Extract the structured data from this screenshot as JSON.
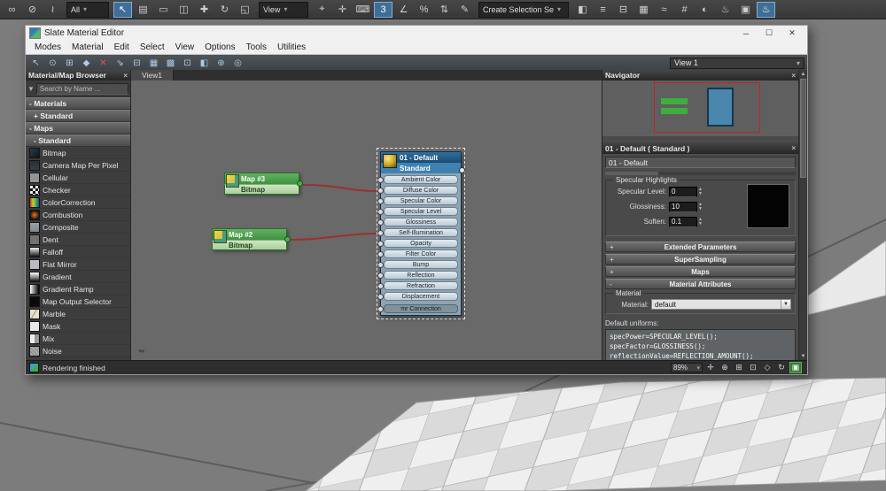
{
  "ui": {
    "close": "×",
    "funnel": "▼",
    "pan_glyph": "●●"
  },
  "top_toolbar": {
    "selection_filter": "All",
    "coord_system": "View",
    "named_selection": "Create Selection Se",
    "icons_g1": [
      {
        "name": "select-and-link-icon",
        "glyph": "∞"
      },
      {
        "name": "unlink-selection-icon",
        "glyph": "⊘"
      },
      {
        "name": "bind-to-spacewarp-icon",
        "glyph": "≀"
      }
    ],
    "icons_g2": [
      {
        "name": "select-object-icon",
        "glyph": "↖",
        "active": true
      },
      {
        "name": "select-by-name-icon",
        "glyph": "▤"
      },
      {
        "name": "rectangular-selection-icon",
        "glyph": "▭"
      },
      {
        "name": "window-crossing-icon",
        "glyph": "◫"
      },
      {
        "name": "select-and-move-icon",
        "glyph": "✚"
      },
      {
        "name": "select-and-rotate-icon",
        "glyph": "↻"
      },
      {
        "name": "select-and-scale-icon",
        "glyph": "◱"
      }
    ],
    "icons_g3": [
      {
        "name": "use-pivot-center-icon",
        "glyph": "⌖"
      },
      {
        "name": "select-and-manipulate-icon",
        "glyph": "✛"
      },
      {
        "name": "keyboard-override-icon",
        "glyph": "⌨"
      },
      {
        "name": "snap-toggle-3d-icon",
        "glyph": "3",
        "active": true
      },
      {
        "name": "angle-snap-icon",
        "glyph": "∠"
      },
      {
        "name": "percent-snap-icon",
        "glyph": "%"
      },
      {
        "name": "spinner-snap-icon",
        "glyph": "⇅"
      },
      {
        "name": "edit-selection-set-icon",
        "glyph": "✎"
      }
    ],
    "icons_g4": [
      {
        "name": "mirror-icon",
        "glyph": "◧"
      },
      {
        "name": "align-icon",
        "glyph": "≡"
      },
      {
        "name": "layer-manager-icon",
        "glyph": "⊟"
      },
      {
        "name": "graphite-ribbon-icon",
        "glyph": "▦"
      },
      {
        "name": "curve-editor-icon",
        "glyph": "≈"
      },
      {
        "name": "schematic-view-icon",
        "glyph": "#"
      },
      {
        "name": "material-editor-icon",
        "glyph": "◐"
      },
      {
        "name": "render-setup-icon",
        "glyph": "♨"
      },
      {
        "name": "rendered-frame-icon",
        "glyph": "▣"
      },
      {
        "name": "render-production-icon",
        "glyph": "♨",
        "active": true
      }
    ]
  },
  "window": {
    "title": "Slate Material Editor",
    "controls": {
      "minimize": "─",
      "maximize": "☐",
      "close": "✕"
    },
    "menus": [
      "Modes",
      "Material",
      "Edit",
      "Select",
      "View",
      "Options",
      "Tools",
      "Utilities"
    ],
    "toolbar_icons": [
      {
        "name": "select-tool-icon",
        "glyph": "↖"
      },
      {
        "name": "pick-material-from-object-icon",
        "glyph": "⊙"
      },
      {
        "name": "put-to-library-icon",
        "glyph": "⊞"
      },
      {
        "name": "assign-material-to-selection-icon",
        "glyph": "◆"
      },
      {
        "name": "delete-selected-icon",
        "glyph": "✕",
        "tone": "red"
      },
      {
        "name": "move-children-icon",
        "glyph": "⇘"
      },
      {
        "name": "hide-unused-nodeslots-icon",
        "glyph": "⊟"
      },
      {
        "name": "show-grid-icon",
        "glyph": "▦"
      },
      {
        "name": "show-background-icon",
        "glyph": "▩"
      },
      {
        "name": "layout-all-icon",
        "glyph": "⊡"
      },
      {
        "name": "show-shaded-material-icon",
        "glyph": "◧"
      },
      {
        "name": "zoom-extents-icon",
        "glyph": "⊕"
      },
      {
        "name": "material-id-channel-icon",
        "glyph": "◎"
      }
    ],
    "view_selector": "View 1",
    "view_tab": "View1"
  },
  "browser": {
    "title": "Material/Map Browser",
    "search_placeholder": "Search by Name ...",
    "groups": [
      {
        "label": "- Materials"
      },
      {
        "label": "+ Standard"
      },
      {
        "label": "- Maps"
      },
      {
        "label": "- Standard"
      }
    ],
    "maps": [
      {
        "label": "Bitmap",
        "icon": "bitmap-icon"
      },
      {
        "label": "Camera Map Per Pixel",
        "icon": "camera-map-icon"
      },
      {
        "label": "Cellular",
        "icon": "cellular-icon"
      },
      {
        "label": "Checker",
        "icon": "checker-icon"
      },
      {
        "label": "ColorCorrection",
        "icon": "colorcorrection-icon"
      },
      {
        "label": "Combustion",
        "icon": "combustion-icon"
      },
      {
        "label": "Composite",
        "icon": "composite-icon"
      },
      {
        "label": "Dent",
        "icon": "dent-icon"
      },
      {
        "label": "Falloff",
        "icon": "falloff-icon"
      },
      {
        "label": "Flat Mirror",
        "icon": "flat-mirror-icon"
      },
      {
        "label": "Gradient",
        "icon": "gradient-icon"
      },
      {
        "label": "Gradient Ramp",
        "icon": "gradient-ramp-icon"
      },
      {
        "label": "Map Output Selector",
        "icon": "map-output-icon"
      },
      {
        "label": "Marble",
        "icon": "marble-icon"
      },
      {
        "label": "Mask",
        "icon": "mask-icon"
      },
      {
        "label": "Mix",
        "icon": "mix-icon"
      },
      {
        "label": "Noise",
        "icon": "noise-icon"
      }
    ]
  },
  "canvas": {
    "nodes": {
      "map3": {
        "title": "Map #3",
        "subtitle": "Bitmap"
      },
      "map2": {
        "title": "Map #2",
        "subtitle": "Bitmap"
      },
      "material": {
        "title": "01 - Default",
        "subtitle": "Standard",
        "slots": [
          "Ambient Color",
          "Diffuse Color",
          "Specular Color",
          "Specular Level",
          "Glossiness",
          "Self-Illumination",
          "Opacity",
          "Filter Color",
          "Bump",
          "Reflection",
          "Refraction",
          "Displacement"
        ],
        "extra_slot": "mr Connection"
      }
    },
    "wire_color": "#9e2f2f"
  },
  "navigator": {
    "title": "Navigator"
  },
  "params": {
    "header": "01 - Default  ( Standard )",
    "name": "01 - Default",
    "specular_group": "Specular Highlights",
    "fields": [
      {
        "label": "Specular Level:",
        "value": "0"
      },
      {
        "label": "Glossiness:",
        "value": "10"
      },
      {
        "label": "Soften:",
        "value": "0.1"
      }
    ],
    "rollouts": [
      {
        "label": "Extended Parameters",
        "state": "+"
      },
      {
        "label": "SuperSampling",
        "state": "+"
      },
      {
        "label": "Maps",
        "state": "+"
      },
      {
        "label": "Material Attributes",
        "state": "-"
      }
    ],
    "material_group": "Material",
    "material_label": "Material:",
    "material_value": "default",
    "uniforms_label": "Default uniforms:",
    "uniforms_code": [
      "specPower=SPECULAR_LEVEL();",
      "specFactor=GLOSSINESS();",
      "reflectionValue=REFLECTION_AMOUNT();"
    ]
  },
  "status": {
    "message": "Rendering finished",
    "zoom": "89%",
    "icons": [
      {
        "name": "pan-view-icon",
        "glyph": "✛"
      },
      {
        "name": "zoom-icon",
        "glyph": "⊕"
      },
      {
        "name": "zoom-extents-icon",
        "glyph": "⊞"
      },
      {
        "name": "zoom-region-icon",
        "glyph": "⊡"
      },
      {
        "name": "field-of-view-icon",
        "glyph": "◇"
      },
      {
        "name": "orbit-icon",
        "glyph": "↻"
      },
      {
        "name": "maximize-viewport-icon",
        "glyph": "▣",
        "tone": "green"
      }
    ]
  }
}
